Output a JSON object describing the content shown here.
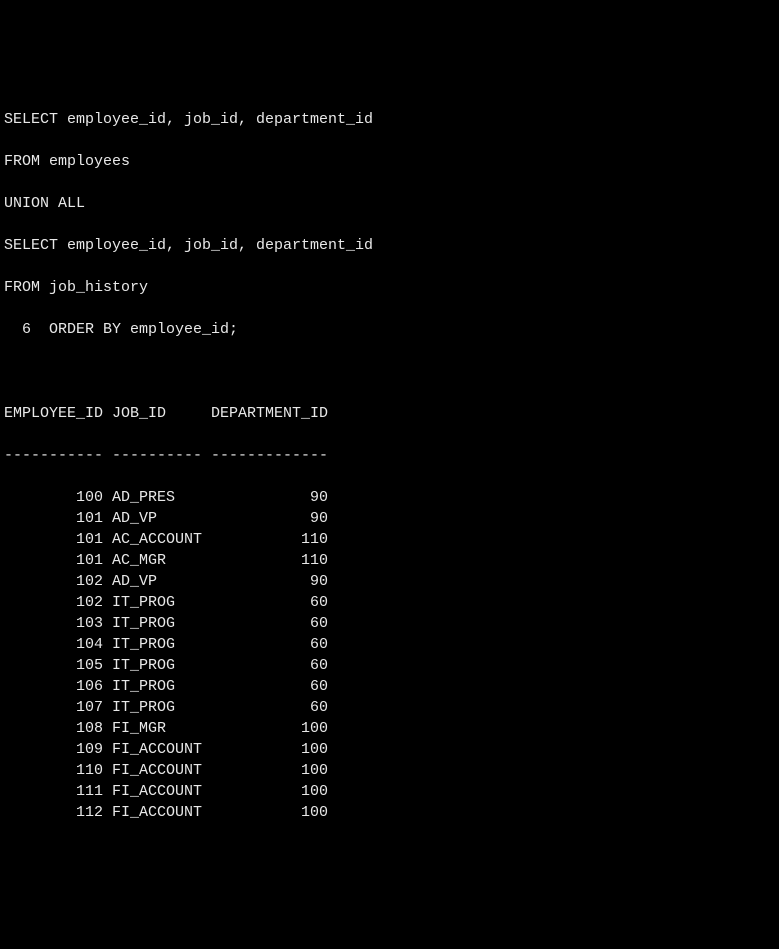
{
  "query": {
    "line1": "SELECT employee_id, job_id, department_id",
    "line2": "FROM employees",
    "line3": "UNION ALL",
    "line4": "SELECT employee_id, job_id, department_id",
    "line5": "FROM job_history",
    "line6": "  6  ORDER BY employee_id;"
  },
  "headers": {
    "col1": "EMPLOYEE_ID",
    "col2": "JOB_ID",
    "col3": "DEPARTMENT_ID"
  },
  "separator": "----------- ---------- -------------",
  "rows": [
    {
      "employee_id": "100",
      "job_id": "AD_PRES",
      "department_id": "90"
    },
    {
      "employee_id": "101",
      "job_id": "AD_VP",
      "department_id": "90"
    },
    {
      "employee_id": "101",
      "job_id": "AC_ACCOUNT",
      "department_id": "110"
    },
    {
      "employee_id": "101",
      "job_id": "AC_MGR",
      "department_id": "110"
    },
    {
      "employee_id": "102",
      "job_id": "AD_VP",
      "department_id": "90"
    },
    {
      "employee_id": "102",
      "job_id": "IT_PROG",
      "department_id": "60"
    },
    {
      "employee_id": "103",
      "job_id": "IT_PROG",
      "department_id": "60"
    },
    {
      "employee_id": "104",
      "job_id": "IT_PROG",
      "department_id": "60"
    },
    {
      "employee_id": "105",
      "job_id": "IT_PROG",
      "department_id": "60"
    },
    {
      "employee_id": "106",
      "job_id": "IT_PROG",
      "department_id": "60"
    },
    {
      "employee_id": "107",
      "job_id": "IT_PROG",
      "department_id": "60"
    },
    {
      "employee_id": "108",
      "job_id": "FI_MGR",
      "department_id": "100"
    },
    {
      "employee_id": "109",
      "job_id": "FI_ACCOUNT",
      "department_id": "100"
    },
    {
      "employee_id": "110",
      "job_id": "FI_ACCOUNT",
      "department_id": "100"
    },
    {
      "employee_id": "111",
      "job_id": "FI_ACCOUNT",
      "department_id": "100"
    },
    {
      "employee_id": "112",
      "job_id": "FI_ACCOUNT",
      "department_id": "100"
    }
  ]
}
